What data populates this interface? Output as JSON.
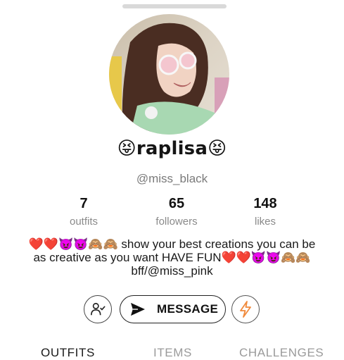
{
  "profile": {
    "display_name": "😝raplisa😝",
    "username": "@miss_black",
    "avatar_icon": "profile-photo"
  },
  "stats": [
    {
      "value": "7",
      "label": "outfits"
    },
    {
      "value": "65",
      "label": "followers"
    },
    {
      "value": "148",
      "label": "likes"
    }
  ],
  "bio": {
    "line1": "❤️❤️😈😈🙈🙈 show your best creations you can be",
    "line2": "as creative as you want HAVE FUN❤️❤️😈😈🙈🙈",
    "line3": "bff/@miss_pink"
  },
  "actions": {
    "follow_icon": "follow-user-icon",
    "message_label": "MESSAGE",
    "message_icon": "send-icon",
    "boost_icon": "lightning-icon",
    "boost_color": "#f08a3c"
  },
  "tabs": [
    {
      "label": "OUTFITS",
      "active": true
    },
    {
      "label": "ITEMS",
      "active": false
    },
    {
      "label": "CHALLENGES",
      "active": false
    }
  ]
}
